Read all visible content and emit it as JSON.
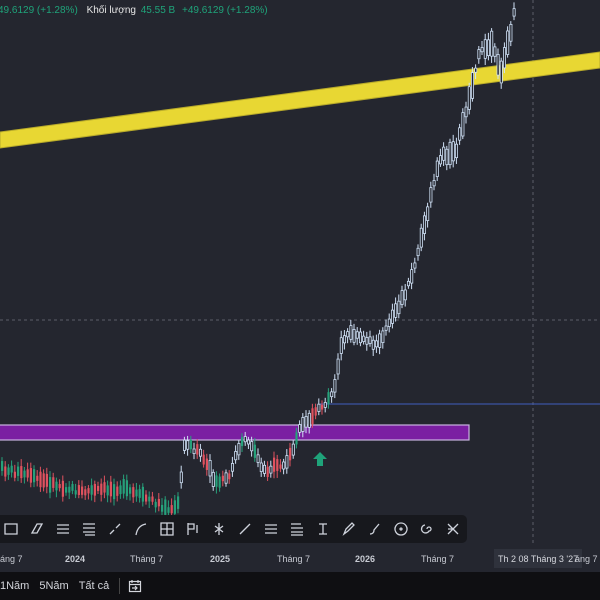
{
  "legend": {
    "change_prefix": "49.6129 (+1.28%)",
    "volume_label": "Khối lượng",
    "volume_value": "45.55 B",
    "volume_change": "+49.6129 (+1.28%)"
  },
  "colors": {
    "up": "#26a17b",
    "down": "#e0525f",
    "hollow": "#cfe0f5",
    "trendline": "#e8d733",
    "zone": "#7b1fa2",
    "level": "#3f5fbf",
    "arrow": "#1fa37a"
  },
  "drawing_tools": [
    "rectangle-icon",
    "parallel-channel-icon",
    "fib-retracement-icon",
    "fib-extension-icon",
    "trend-angle-icon",
    "path-icon",
    "gann-box-icon",
    "flag-icon",
    "pitchfork-icon",
    "line-icon",
    "horizontal-lines-icon",
    "fib-channel-icon",
    "price-range-icon",
    "pencil-icon",
    "brush-icon",
    "circle-icon",
    "spiral-icon",
    "pattern-icon"
  ],
  "time_axis": {
    "ticks": [
      {
        "label": "áng 7",
        "bold": false
      },
      {
        "label": "2024",
        "bold": true
      },
      {
        "label": "Tháng 7",
        "bold": false
      },
      {
        "label": "2025",
        "bold": true
      },
      {
        "label": "Tháng 7",
        "bold": false
      },
      {
        "label": "2026",
        "bold": true
      },
      {
        "label": "Tháng 7",
        "bold": false
      },
      {
        "label": "áng 7",
        "bold": false
      }
    ],
    "crosshair_label": "Th 2 08 Tháng 3 '27"
  },
  "range_bar": {
    "items": [
      "1Năm",
      "5Năm",
      "Tất cả"
    ],
    "goto_icon": "calendar-goto-icon"
  }
}
